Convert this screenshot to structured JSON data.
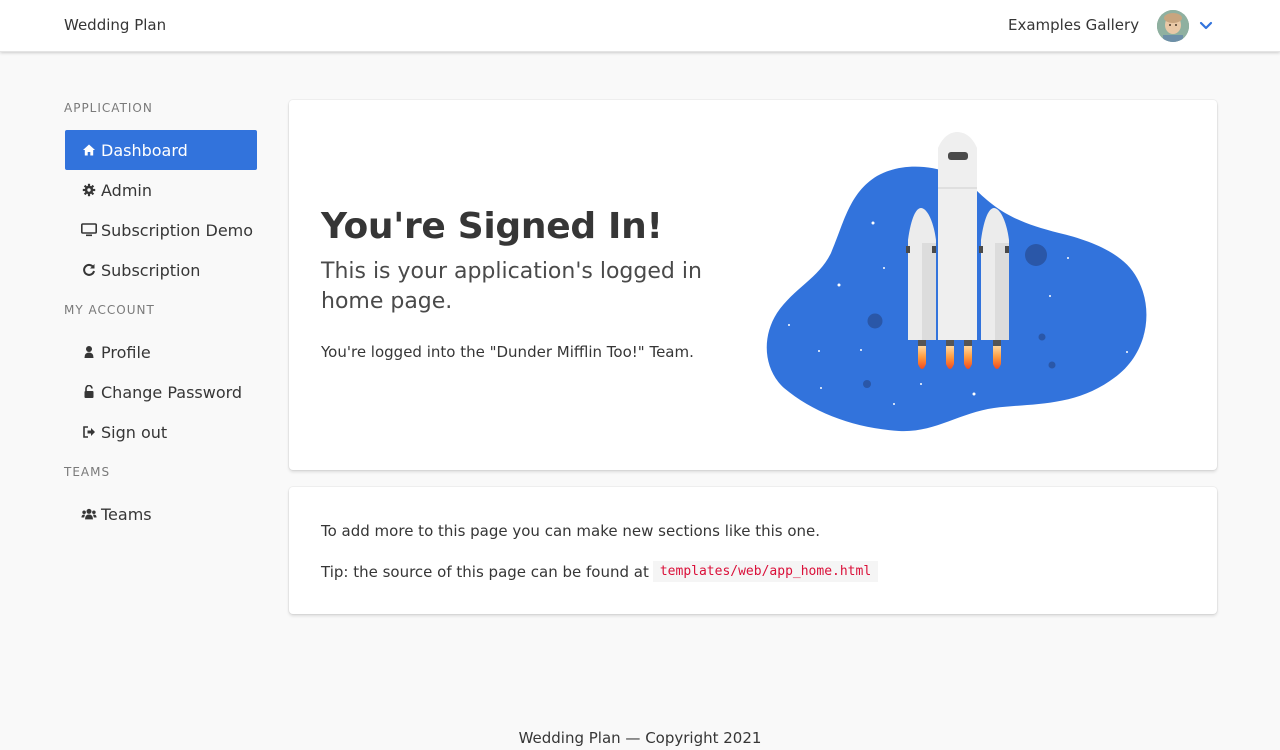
{
  "navbar": {
    "brand": "Wedding Plan",
    "examples_link": "Examples Gallery",
    "avatar_icon": "user-avatar",
    "dropdown_icon": "chevron-down-icon",
    "accent_color": "#3273dc"
  },
  "sidebar": {
    "sections": {
      "application": "APPLICATION",
      "my_account": "MY ACCOUNT",
      "teams": "TEAMS"
    },
    "items": {
      "dashboard": {
        "label": "Dashboard",
        "icon": "home-icon",
        "active": true
      },
      "admin": {
        "label": "Admin",
        "icon": "gear-icon"
      },
      "subscription_demo": {
        "label": "Subscription Demo",
        "icon": "desktop-icon"
      },
      "subscription": {
        "label": "Subscription",
        "icon": "refresh-icon"
      },
      "profile": {
        "label": "Profile",
        "icon": "user-icon"
      },
      "change_password": {
        "label": "Change Password",
        "icon": "unlock-icon"
      },
      "sign_out": {
        "label": "Sign out",
        "icon": "sign-out-icon"
      },
      "teams": {
        "label": "Teams",
        "icon": "users-icon"
      }
    }
  },
  "main": {
    "hero": {
      "title": "You're Signed In!",
      "subtitle": "This is your application's logged in home page.",
      "team_text": "You're logged into the \"Dunder Mifflin Too!\" Team.",
      "illustration": "rocket-launch-illustration"
    },
    "info": {
      "line1": "To add more to this page you can make new sections like this one.",
      "tip_prefix": "Tip: the source of this page can be found at",
      "tip_code": "templates/web/app_home.html"
    }
  },
  "footer": {
    "text": "Wedding Plan — Copyright 2021"
  }
}
